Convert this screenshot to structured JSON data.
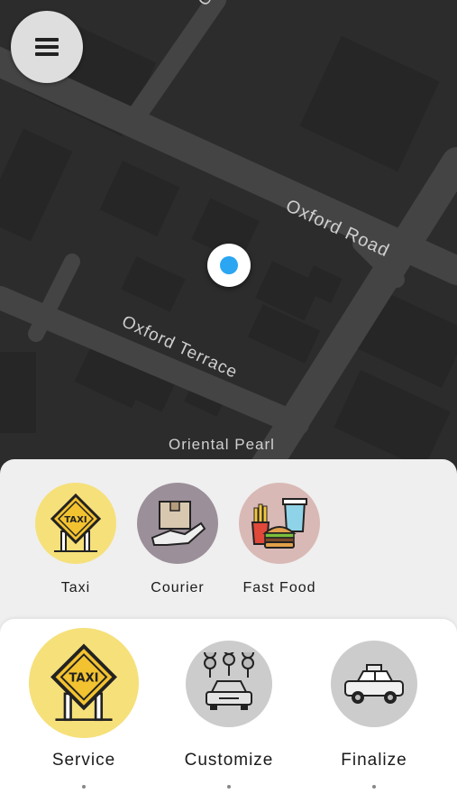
{
  "map": {
    "streets": [
      "Oxford Road",
      "Oxford Terrace",
      "Oriental Pearl",
      "Ox"
    ]
  },
  "categories": [
    {
      "label": "Taxi",
      "icon": "taxi-sign-icon",
      "bg": "#f6e07a"
    },
    {
      "label": "Courier",
      "icon": "courier-package-icon",
      "bg": "#9b8f99"
    },
    {
      "label": "Fast Food",
      "icon": "fast-food-icon",
      "bg": "#d9b9b5"
    }
  ],
  "steps": [
    {
      "label": "Service",
      "icon": "taxi-sign-icon",
      "bg": "#f6e07a",
      "active": true
    },
    {
      "label": "Customize",
      "icon": "car-locations-icon",
      "bg": "#cccccc",
      "active": false
    },
    {
      "label": "Finalize",
      "icon": "taxi-car-icon",
      "bg": "#cccccc",
      "active": false
    }
  ],
  "colors": {
    "accent_yellow": "#f6e07a",
    "location_blue": "#2aa6f2",
    "map_bg": "#2c2c2c"
  }
}
